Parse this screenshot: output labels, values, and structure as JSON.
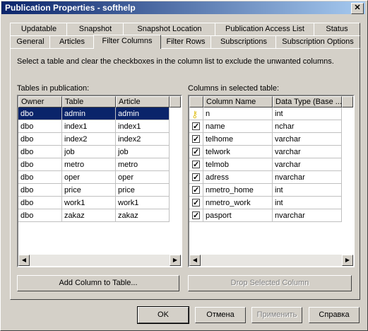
{
  "window": {
    "title": "Publication Properties - softhelp",
    "close_glyph": "✕"
  },
  "tabs_back": [
    "Updatable",
    "Snapshot",
    "Snapshot Location",
    "Publication Access List",
    "Status"
  ],
  "tabs_front": [
    "General",
    "Articles",
    "Filter Columns",
    "Filter Rows",
    "Subscriptions",
    "Subscription Options"
  ],
  "instruction": "Select a table and clear the checkboxes in the column list to exclude the unwanted columns.",
  "tables": {
    "label": "Tables in publication:",
    "headers": [
      "Owner",
      "Table",
      "Article"
    ],
    "rows": [
      [
        "dbo",
        "admin",
        "admin"
      ],
      [
        "dbo",
        "index1",
        "index1"
      ],
      [
        "dbo",
        "index2",
        "index2"
      ],
      [
        "dbo",
        "job",
        "job"
      ],
      [
        "dbo",
        "metro",
        "metro"
      ],
      [
        "dbo",
        "oper",
        "oper"
      ],
      [
        "dbo",
        "price",
        "price"
      ],
      [
        "dbo",
        "work1",
        "work1"
      ],
      [
        "dbo",
        "zakaz",
        "zakaz"
      ]
    ],
    "selected_index": 0
  },
  "columns": {
    "label": "Columns in selected table:",
    "headers": [
      "Column Name",
      "Data Type (Base ..."
    ],
    "rows": [
      {
        "name": "n",
        "type": "int",
        "key": true
      },
      {
        "name": "name",
        "type": "nchar",
        "checked": true
      },
      {
        "name": "telhome",
        "type": "varchar",
        "checked": true
      },
      {
        "name": "telwork",
        "type": "varchar",
        "checked": true
      },
      {
        "name": "telmob",
        "type": "varchar",
        "checked": true
      },
      {
        "name": "adress",
        "type": "nvarchar",
        "checked": true
      },
      {
        "name": "nmetro_home",
        "type": "int",
        "checked": true
      },
      {
        "name": "nmetro_work",
        "type": "int",
        "checked": true
      },
      {
        "name": "pasport",
        "type": "nvarchar",
        "checked": true
      }
    ]
  },
  "buttons": {
    "add_column": "Add Column to Table...",
    "drop_column": "Drop Selected Column",
    "ok": "OK",
    "cancel": "Отмена",
    "apply": "Применить",
    "help": "Справка"
  },
  "colors": {
    "selection": "#0a246a",
    "face": "#d4d0c8",
    "key_icon": "#e0c020"
  }
}
